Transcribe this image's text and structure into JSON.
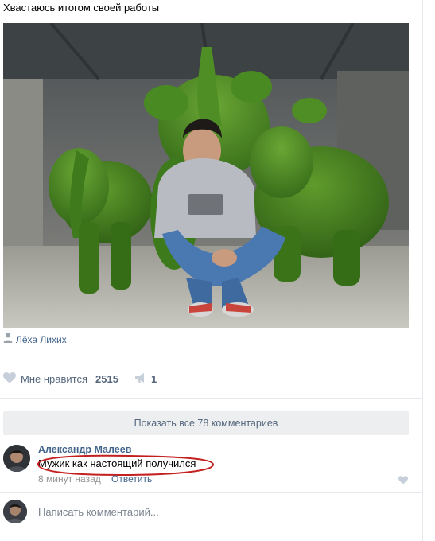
{
  "post": {
    "text": "Хвастаюсь итогом своей работы",
    "photo_alt": "photo",
    "author_name": "Лёха Лихих"
  },
  "actions": {
    "like_label": "Мне нравится",
    "like_count": "2515",
    "share_count": "1"
  },
  "comments": {
    "show_all_label": "Показать все 78 комментариев",
    "items": [
      {
        "author": "Александр Малеев",
        "text": "Мужик как настоящий получился",
        "time": "8 минут назад",
        "reply_label": "Ответить"
      }
    ]
  },
  "composer": {
    "placeholder": "Написать комментарий..."
  },
  "colors": {
    "link": "#42648b",
    "muted": "#55677d",
    "button_bg": "#edeef0",
    "divider": "#e7e8ec",
    "highlight": "#c41f1f"
  },
  "icons": {
    "author": "user-icon",
    "like": "heart-icon",
    "share": "megaphone-icon"
  }
}
